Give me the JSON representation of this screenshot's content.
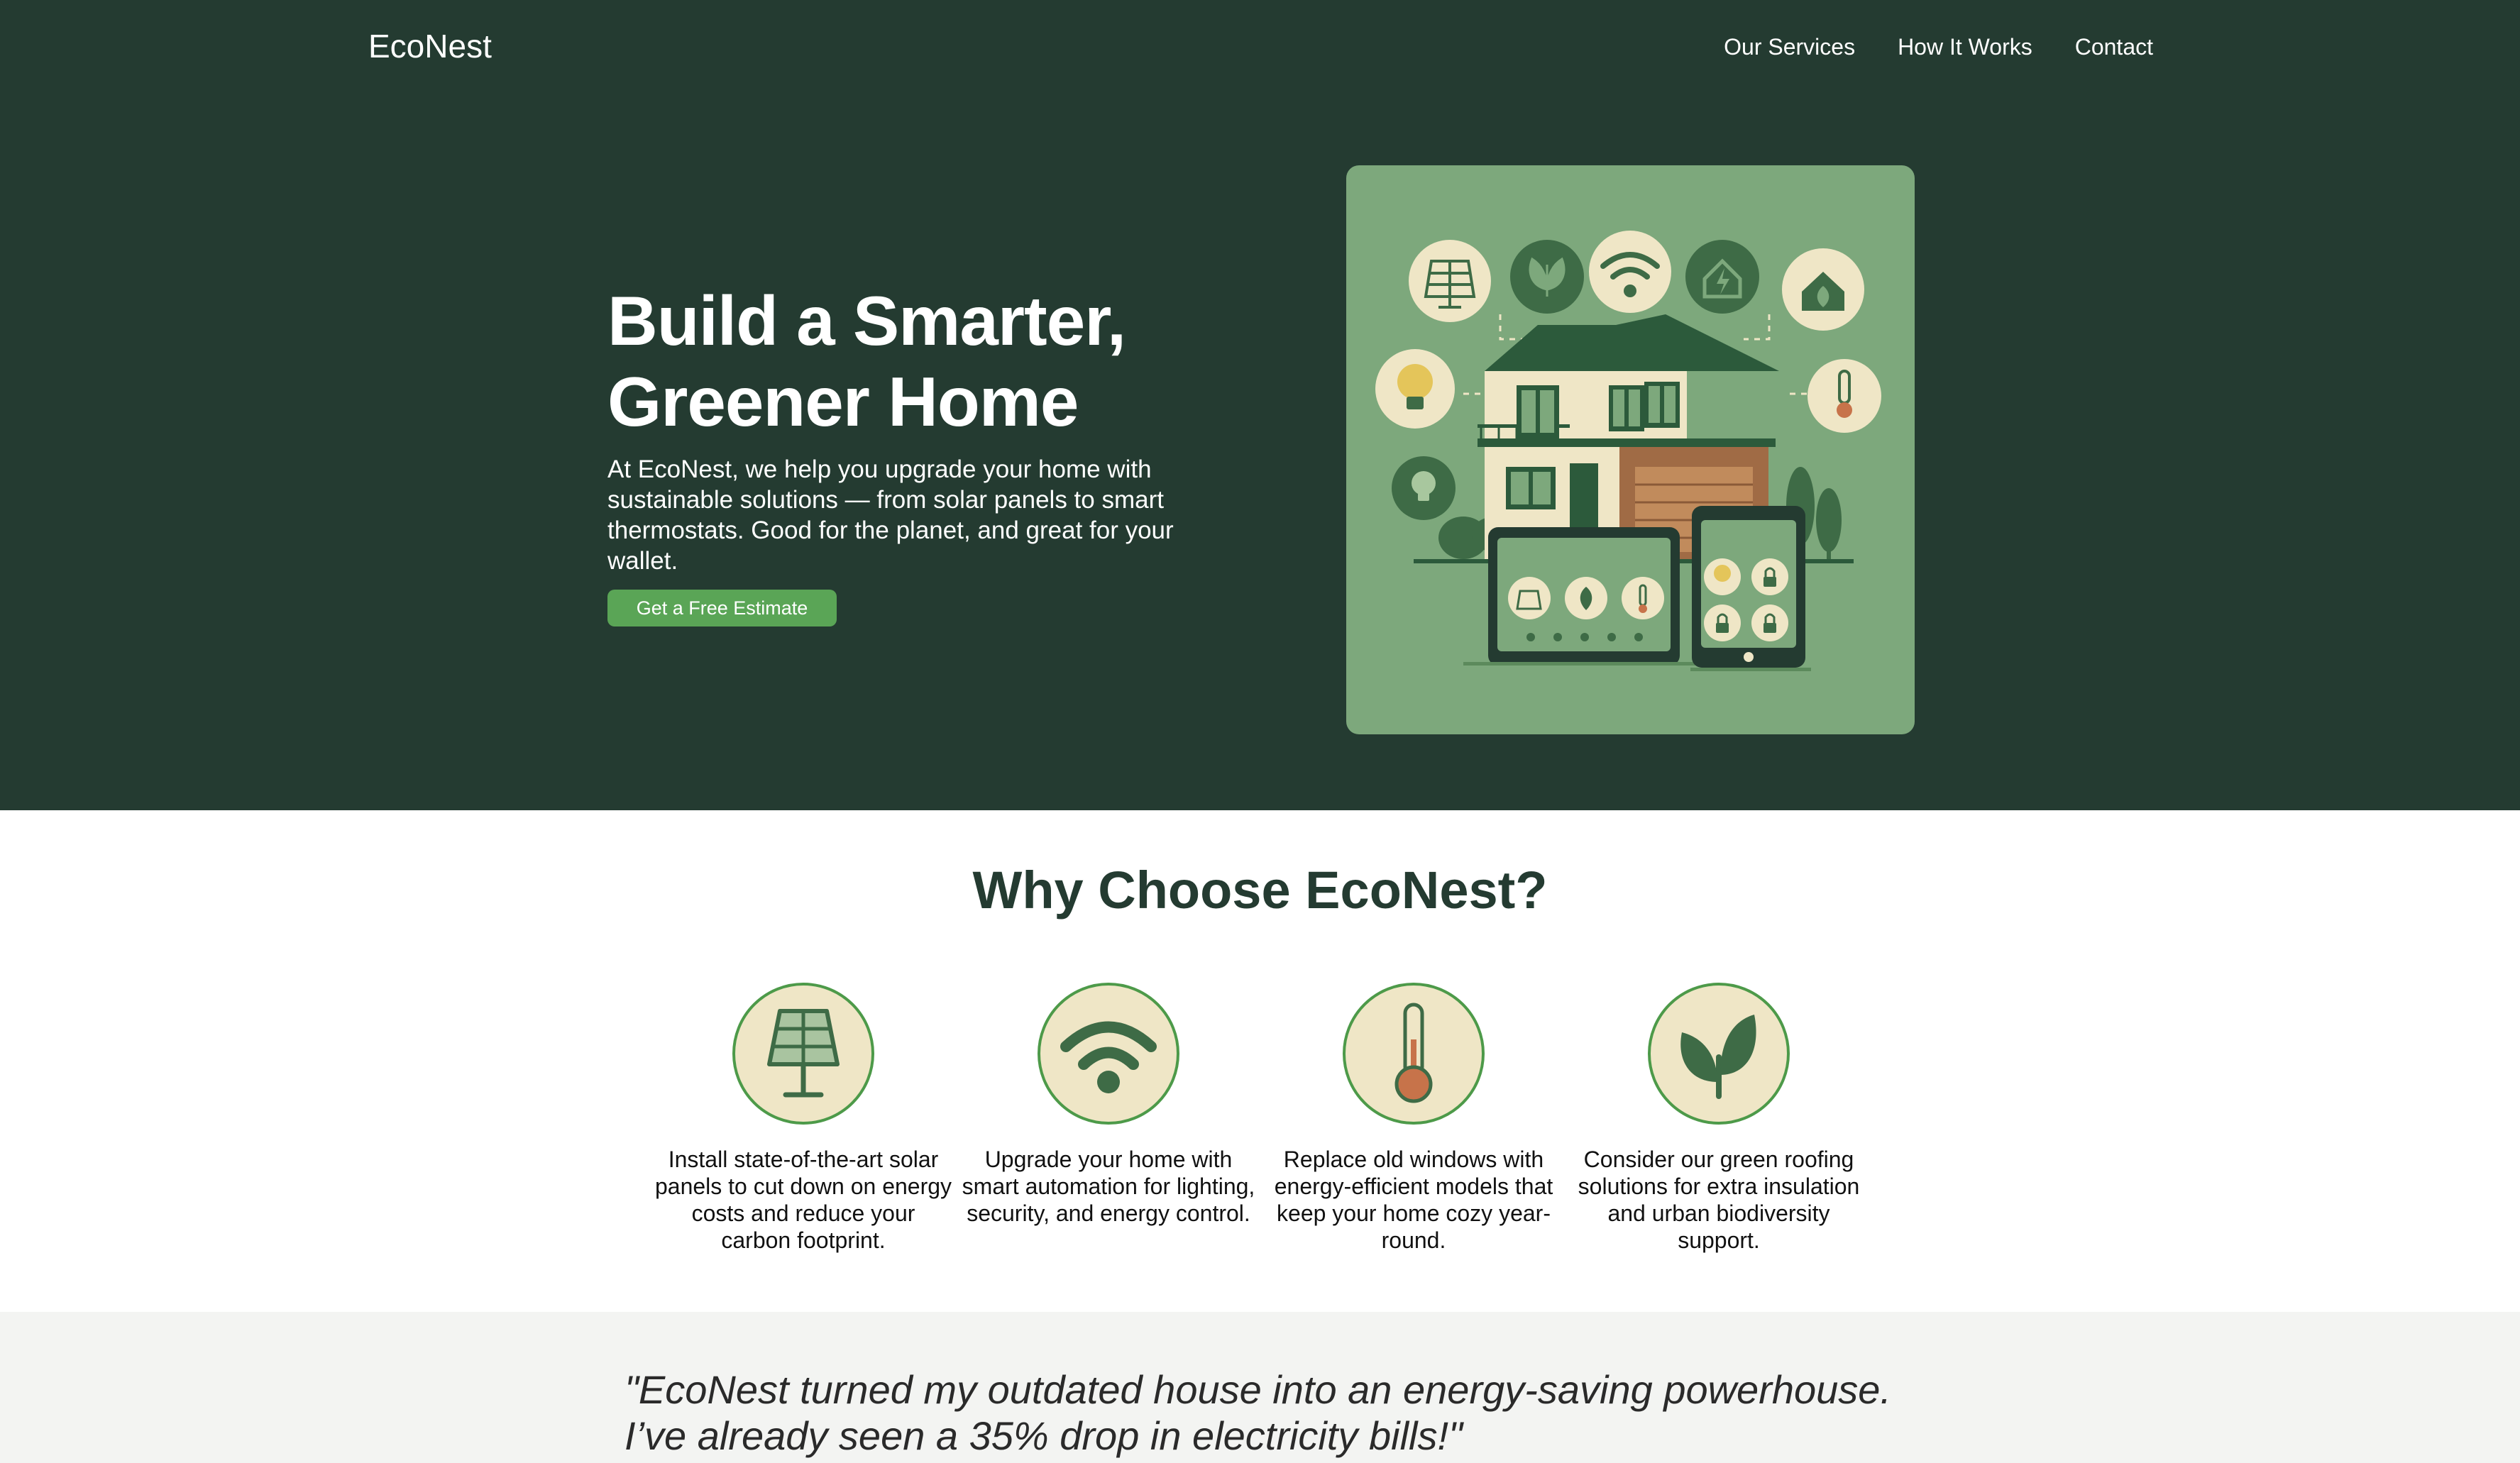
{
  "header": {
    "brand": "EcoNest",
    "nav": [
      "Our Services",
      "How It Works",
      "Contact"
    ]
  },
  "hero": {
    "title_line1": "Build a Smarter,",
    "title_line2": "Greener Home",
    "description": "At EcoNest, we help you upgrade your home with sustainable solutions — from solar panels to smart thermostats. Good for the planet, and great for your wallet.",
    "cta_label": "Get a Free Estimate",
    "illustration_icons": [
      "solar-panel-icon",
      "leaf-icon",
      "wifi-icon",
      "energy-home-icon",
      "eco-home-icon",
      "lightbulb-icon",
      "thermometer-icon",
      "lightbulb-icon",
      "lock-icon"
    ]
  },
  "why": {
    "title": "Why Choose EcoNest?",
    "features": [
      {
        "icon": "solar-panel-icon",
        "text": "Install state-of-the-art solar panels to cut down on energy costs and reduce your carbon footprint."
      },
      {
        "icon": "wifi-icon",
        "text": "Upgrade your home with smart automation for lighting, security, and energy control."
      },
      {
        "icon": "thermometer-icon",
        "text": "Replace old windows with energy-efficient models that keep your home cozy year-round."
      },
      {
        "icon": "leaf-icon",
        "text": "Consider our green roofing solutions for extra insulation and urban biodiversity support."
      }
    ]
  },
  "testimonial": {
    "quote": "\"EcoNest turned my outdated house into an energy-saving powerhouse. I’ve already seen a 35% drop in electricity bills!\""
  },
  "colors": {
    "hero_bg": "#243b31",
    "accent": "#5aa556",
    "illustration_bg": "#7da87c",
    "icon_fill": "#efe6c6",
    "testimonial_bg": "#f3f4f2"
  }
}
